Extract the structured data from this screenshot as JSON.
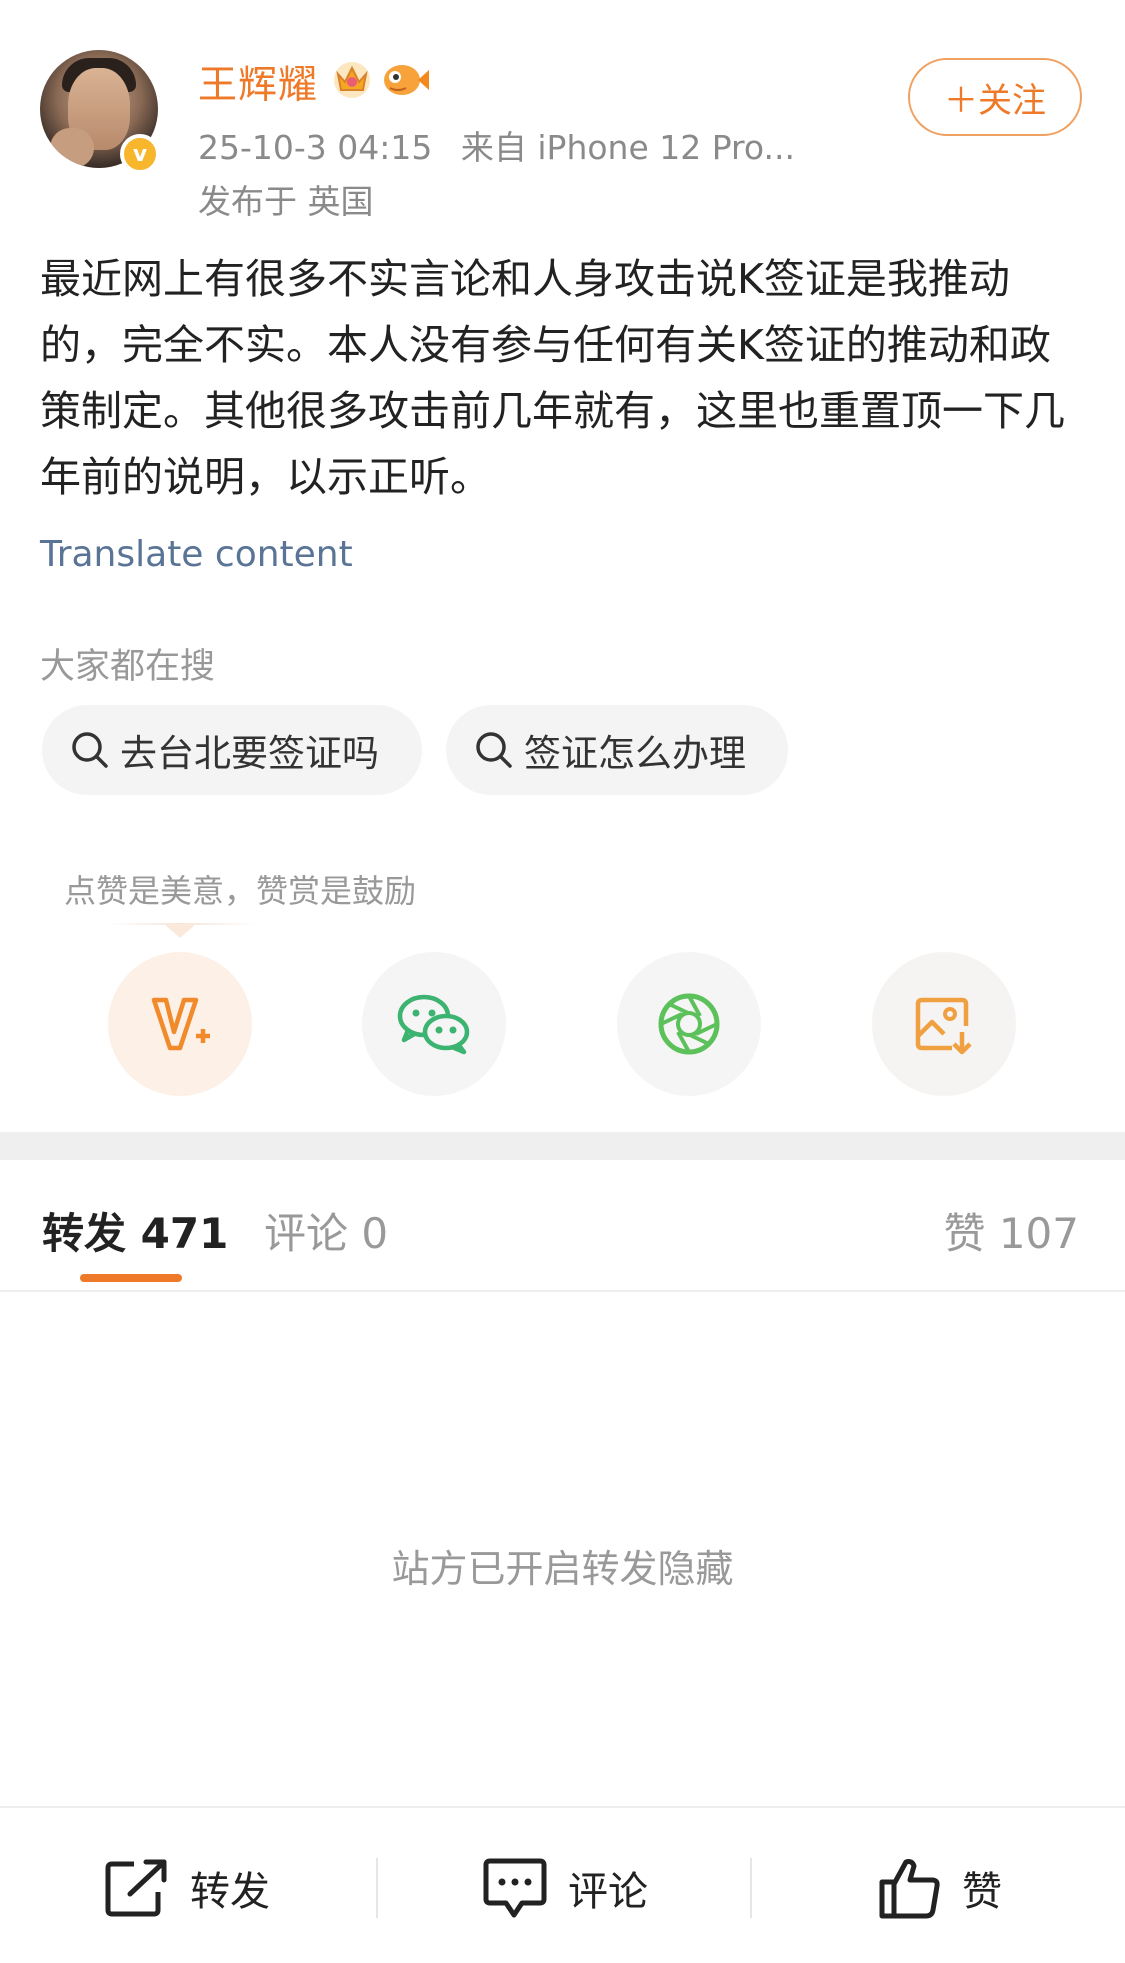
{
  "author": {
    "name": "王辉耀",
    "verified_mark": "v",
    "badges": [
      "crown-badge-icon",
      "fish-badge-icon"
    ]
  },
  "post": {
    "timestamp": "25-10-3 04:15",
    "source": "来自 iPhone 12 Pro...",
    "location": "发布于 英国",
    "text": "最近网上有很多不实言论和人身攻击说K签证是我推动的，完全不实。本人没有参与任何有关K签证的推动和政策制定。其他很多攻击前几年就有，这里也重置顶一下几年前的说明，以示正听。",
    "translate_label": "Translate content"
  },
  "follow_button": {
    "label": "＋关注"
  },
  "search_section": {
    "title": "大家都在搜",
    "chips": [
      "去台北要签证吗",
      "签证怎么办理"
    ]
  },
  "reward_tip": "点赞是美意，赞赏是鼓励",
  "share_targets": [
    "vplus-icon",
    "wechat-icon",
    "moments-icon",
    "save-image-icon"
  ],
  "tabs": {
    "repost": {
      "label": "转发",
      "count": "471"
    },
    "comment": {
      "label": "评论",
      "count": "0"
    },
    "like": {
      "label": "赞",
      "count": "107"
    }
  },
  "empty_state": "站方已开启转发隐藏",
  "bottom_bar": {
    "repost": "转发",
    "comment": "评论",
    "like": "赞"
  },
  "colors": {
    "accent": "#ee7a29",
    "link": "#5a7496",
    "wechat_green": "#3cb371"
  }
}
